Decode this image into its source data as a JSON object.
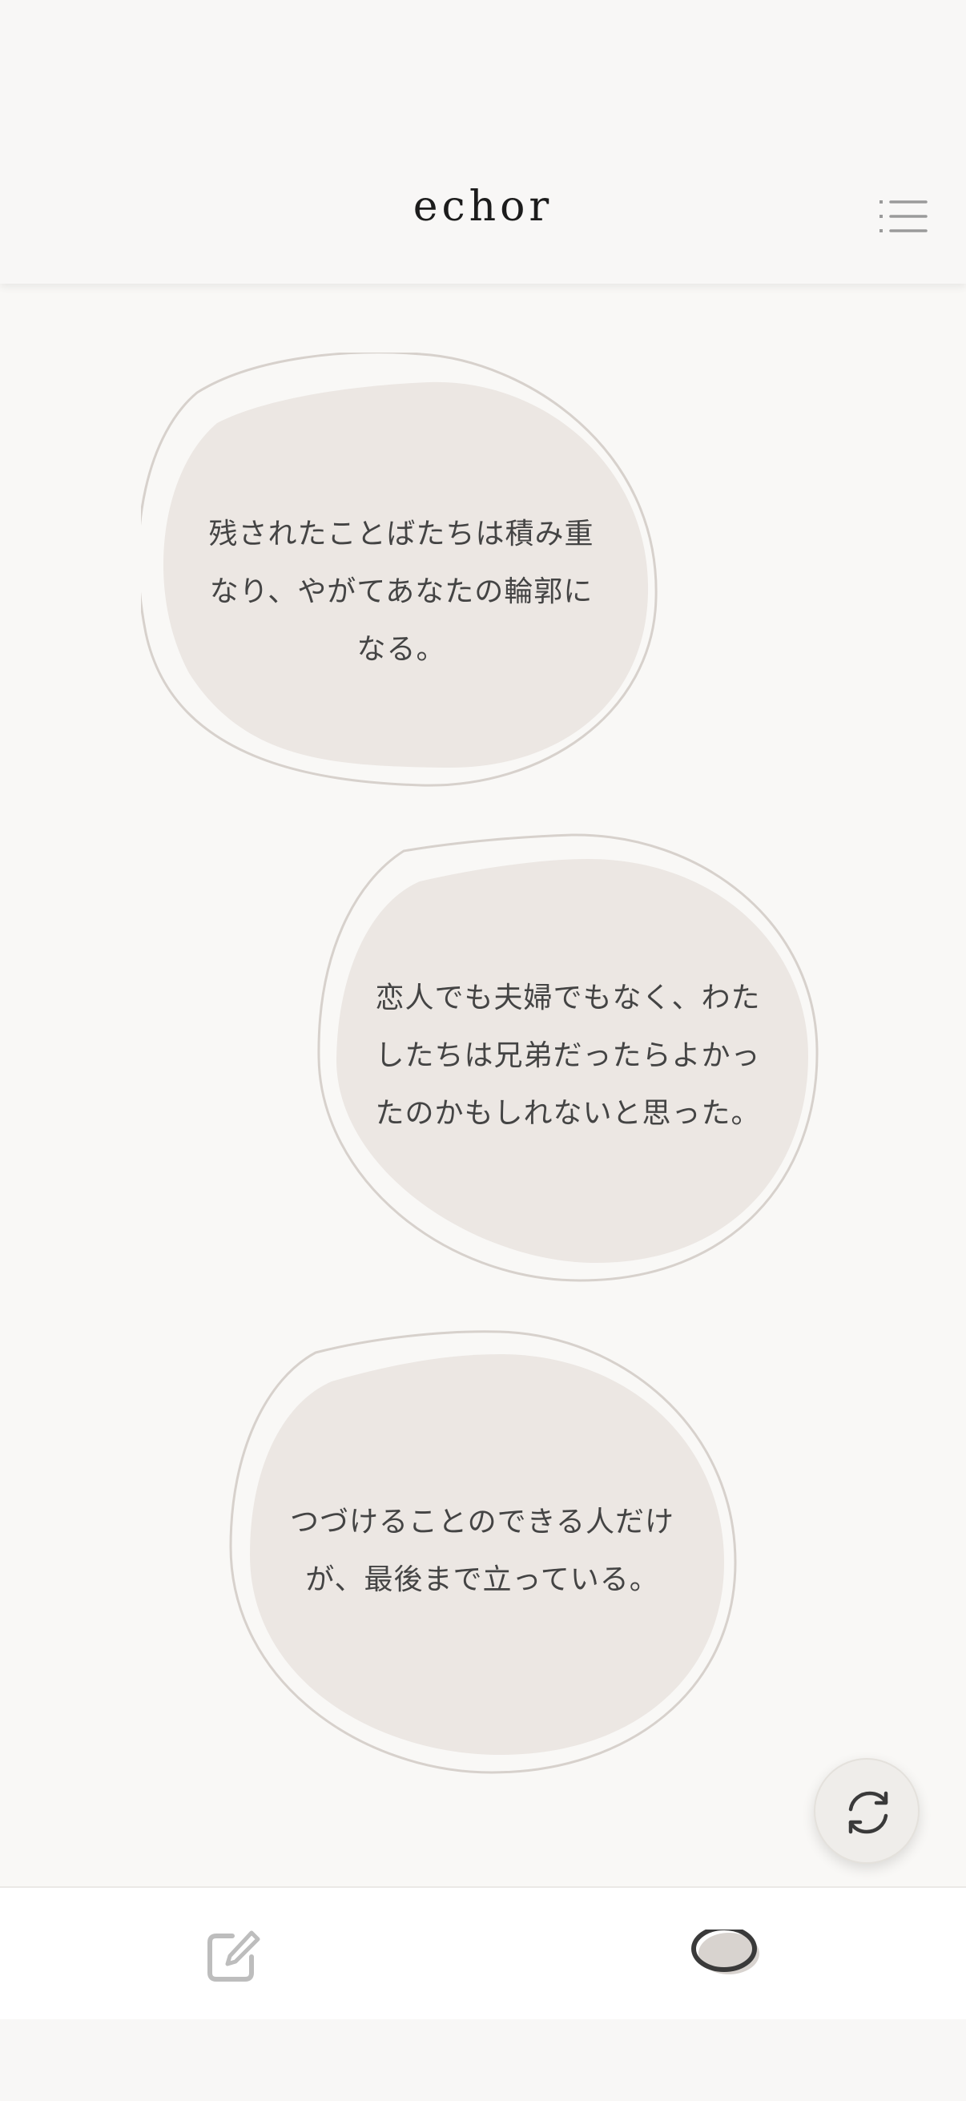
{
  "app": {
    "title": "echor"
  },
  "header": {
    "menu_icon": "list-menu-icon"
  },
  "cards": [
    {
      "lines": [
        "残されたことばたちは積み重",
        "なり、やがてあなたの輪郭に",
        "なる。"
      ]
    },
    {
      "lines": [
        "恋人でも夫婦でもなく、わた",
        "したちは兄弟だったらよかっ",
        "たのかもしれないと思った。"
      ]
    },
    {
      "lines": [
        "つづけることのできる人だけ",
        "が、最後まで立っている。"
      ]
    }
  ],
  "fab": {
    "icon": "refresh-icon"
  },
  "bottom_nav": {
    "items": [
      {
        "icon": "compose-icon",
        "active": false
      },
      {
        "icon": "bubble-icon",
        "active": true
      }
    ]
  },
  "colors": {
    "background": "#f9f8f6",
    "bubble_fill": "#ece7e3",
    "bubble_outline": "#d7d1cc",
    "text": "#444444",
    "title": "#1c1c1c",
    "icon_muted": "#9a9a9a"
  }
}
